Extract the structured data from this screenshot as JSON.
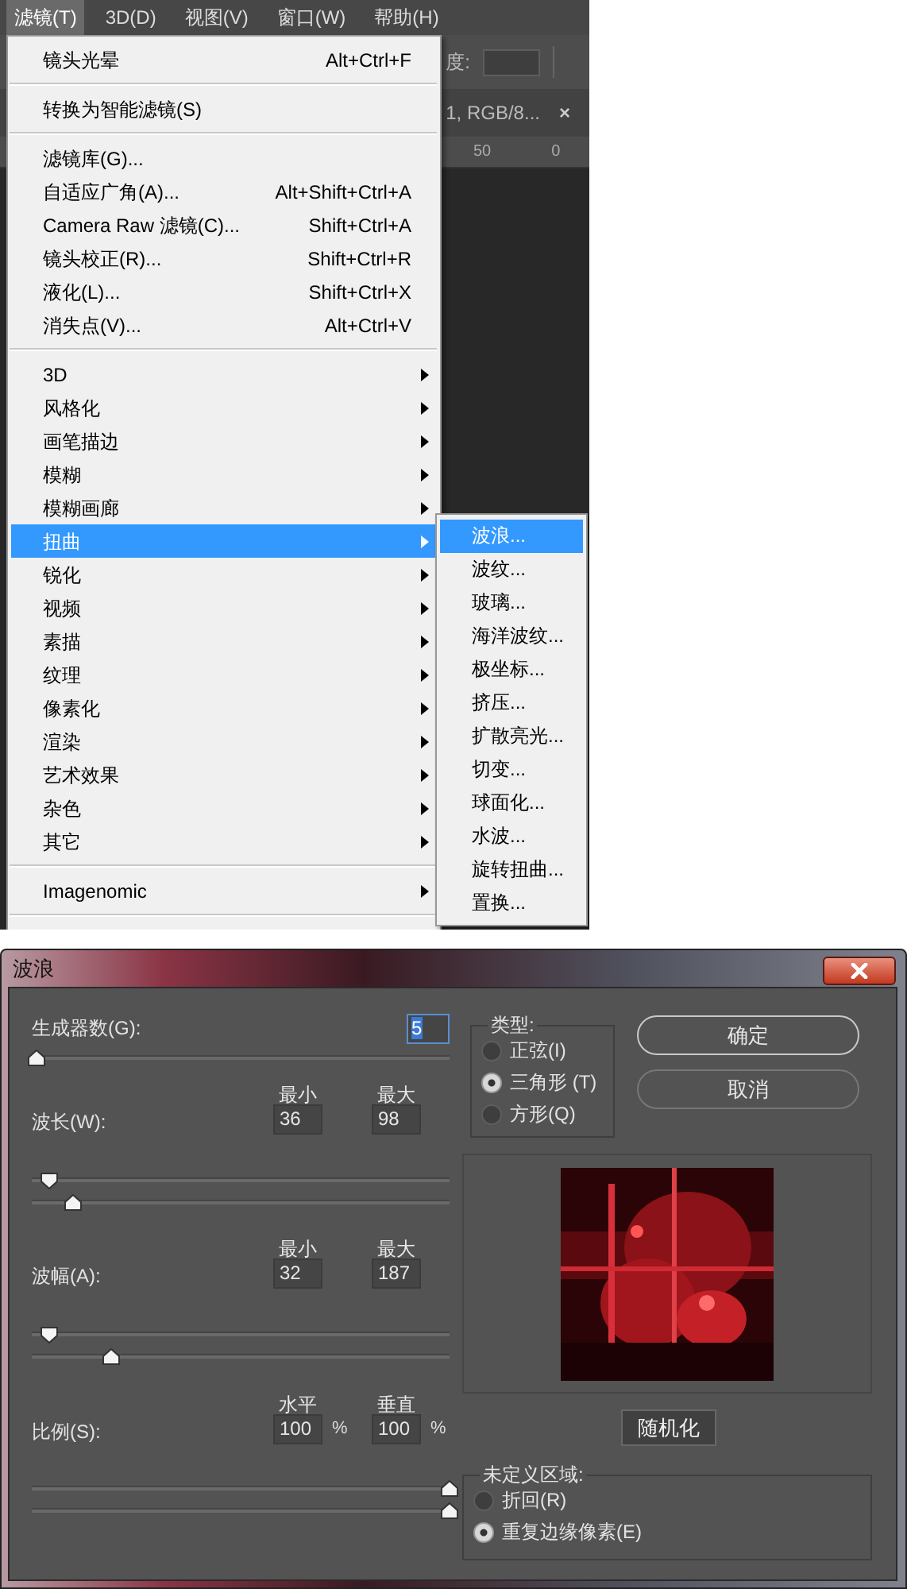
{
  "menu_bar": [
    {
      "label": "滤镜(T)",
      "selected": true
    },
    {
      "label": "3D(D)",
      "selected": false
    },
    {
      "label": "视图(V)",
      "selected": false
    },
    {
      "label": "窗口(W)",
      "selected": false
    },
    {
      "label": "帮助(H)",
      "selected": false
    }
  ],
  "options_bar": {
    "label": "度:"
  },
  "document_tab": {
    "title": "1, RGB/8...",
    "close": "×"
  },
  "ruler": {
    "labels": [
      "50",
      "0"
    ]
  },
  "filter_menu": {
    "items": [
      {
        "kind": "item",
        "label": "镜头光晕",
        "shortcut": "Alt+Ctrl+F",
        "selected": false
      },
      {
        "kind": "separator"
      },
      {
        "kind": "item",
        "label": "转换为智能滤镜(S)",
        "selected": false
      },
      {
        "kind": "separator"
      },
      {
        "kind": "item",
        "label": "滤镜库(G)...",
        "selected": false
      },
      {
        "kind": "item",
        "label": "自适应广角(A)...",
        "shortcut": "Alt+Shift+Ctrl+A",
        "selected": false
      },
      {
        "kind": "item",
        "label": "Camera Raw 滤镜(C)...",
        "shortcut": "Shift+Ctrl+A",
        "selected": false
      },
      {
        "kind": "item",
        "label": "镜头校正(R)...",
        "shortcut": "Shift+Ctrl+R",
        "selected": false
      },
      {
        "kind": "item",
        "label": "液化(L)...",
        "shortcut": "Shift+Ctrl+X",
        "selected": false
      },
      {
        "kind": "item",
        "label": "消失点(V)...",
        "shortcut": "Alt+Ctrl+V",
        "selected": false
      },
      {
        "kind": "separator"
      },
      {
        "kind": "submenu",
        "label": "3D",
        "selected": false
      },
      {
        "kind": "submenu",
        "label": "风格化",
        "selected": false
      },
      {
        "kind": "submenu",
        "label": "画笔描边",
        "selected": false
      },
      {
        "kind": "submenu",
        "label": "模糊",
        "selected": false
      },
      {
        "kind": "submenu",
        "label": "模糊画廊",
        "selected": false
      },
      {
        "kind": "submenu",
        "label": "扭曲",
        "selected": true
      },
      {
        "kind": "submenu",
        "label": "锐化",
        "selected": false
      },
      {
        "kind": "submenu",
        "label": "视频",
        "selected": false
      },
      {
        "kind": "submenu",
        "label": "素描",
        "selected": false
      },
      {
        "kind": "submenu",
        "label": "纹理",
        "selected": false
      },
      {
        "kind": "submenu",
        "label": "像素化",
        "selected": false
      },
      {
        "kind": "submenu",
        "label": "渲染",
        "selected": false
      },
      {
        "kind": "submenu",
        "label": "艺术效果",
        "selected": false
      },
      {
        "kind": "submenu",
        "label": "杂色",
        "selected": false
      },
      {
        "kind": "submenu",
        "label": "其它",
        "selected": false
      },
      {
        "kind": "separator"
      },
      {
        "kind": "submenu",
        "label": "Imagenomic",
        "selected": false
      },
      {
        "kind": "separator"
      }
    ]
  },
  "distort_submenu": {
    "items": [
      {
        "label": "波浪...",
        "selected": true
      },
      {
        "label": "波纹...",
        "selected": false
      },
      {
        "label": "玻璃...",
        "selected": false
      },
      {
        "label": "海洋波纹...",
        "selected": false
      },
      {
        "label": "极坐标...",
        "selected": false
      },
      {
        "label": "挤压...",
        "selected": false
      },
      {
        "label": "扩散亮光...",
        "selected": false
      },
      {
        "label": "切变...",
        "selected": false
      },
      {
        "label": "球面化...",
        "selected": false
      },
      {
        "label": "水波...",
        "selected": false
      },
      {
        "label": "旋转扭曲...",
        "selected": false
      },
      {
        "label": "置换...",
        "selected": false
      }
    ]
  },
  "wave_dialog": {
    "title": "波浪",
    "generators": {
      "label": "生成器数(G):",
      "value": "5",
      "text_selected": true,
      "slider": {
        "level": 0.01,
        "kind": "up"
      }
    },
    "params": [
      {
        "label": "波长(W):",
        "fields": [
          {
            "header": "最小",
            "value": "36"
          },
          {
            "header": "最大",
            "value": "98"
          }
        ],
        "sliders": [
          {
            "level": 0.04,
            "kind": "down"
          },
          {
            "level": 0.1,
            "kind": "up"
          }
        ]
      },
      {
        "label": "波幅(A):",
        "fields": [
          {
            "header": "最小",
            "value": "32"
          },
          {
            "header": "最大",
            "value": "187"
          }
        ],
        "sliders": [
          {
            "level": 0.04,
            "kind": "down"
          },
          {
            "level": 0.19,
            "kind": "up"
          }
        ]
      },
      {
        "label": "比例(S):",
        "fields": [
          {
            "header": "水平",
            "value": "100",
            "unit": "%"
          },
          {
            "header": "垂直",
            "value": "100",
            "unit": "%"
          }
        ],
        "sliders": [
          {
            "level": 1,
            "kind": "up"
          },
          {
            "level": 1,
            "kind": "up"
          }
        ]
      }
    ],
    "type_group": {
      "legend": "类型:",
      "options": [
        {
          "label": "正弦(I)",
          "selected": false
        },
        {
          "label": "三角形 (T)",
          "selected": true
        },
        {
          "label": "方形(Q)",
          "selected": false
        }
      ]
    },
    "buttons": [
      {
        "label": "确定",
        "default": true
      },
      {
        "label": "取消",
        "default": false
      }
    ],
    "randomize_button": "随机化",
    "undefined_area": {
      "legend": "未定义区域:",
      "options": [
        {
          "label": "折回(R)",
          "selected": false
        },
        {
          "label": "重复边缘像素(E)",
          "selected": true
        }
      ]
    }
  }
}
